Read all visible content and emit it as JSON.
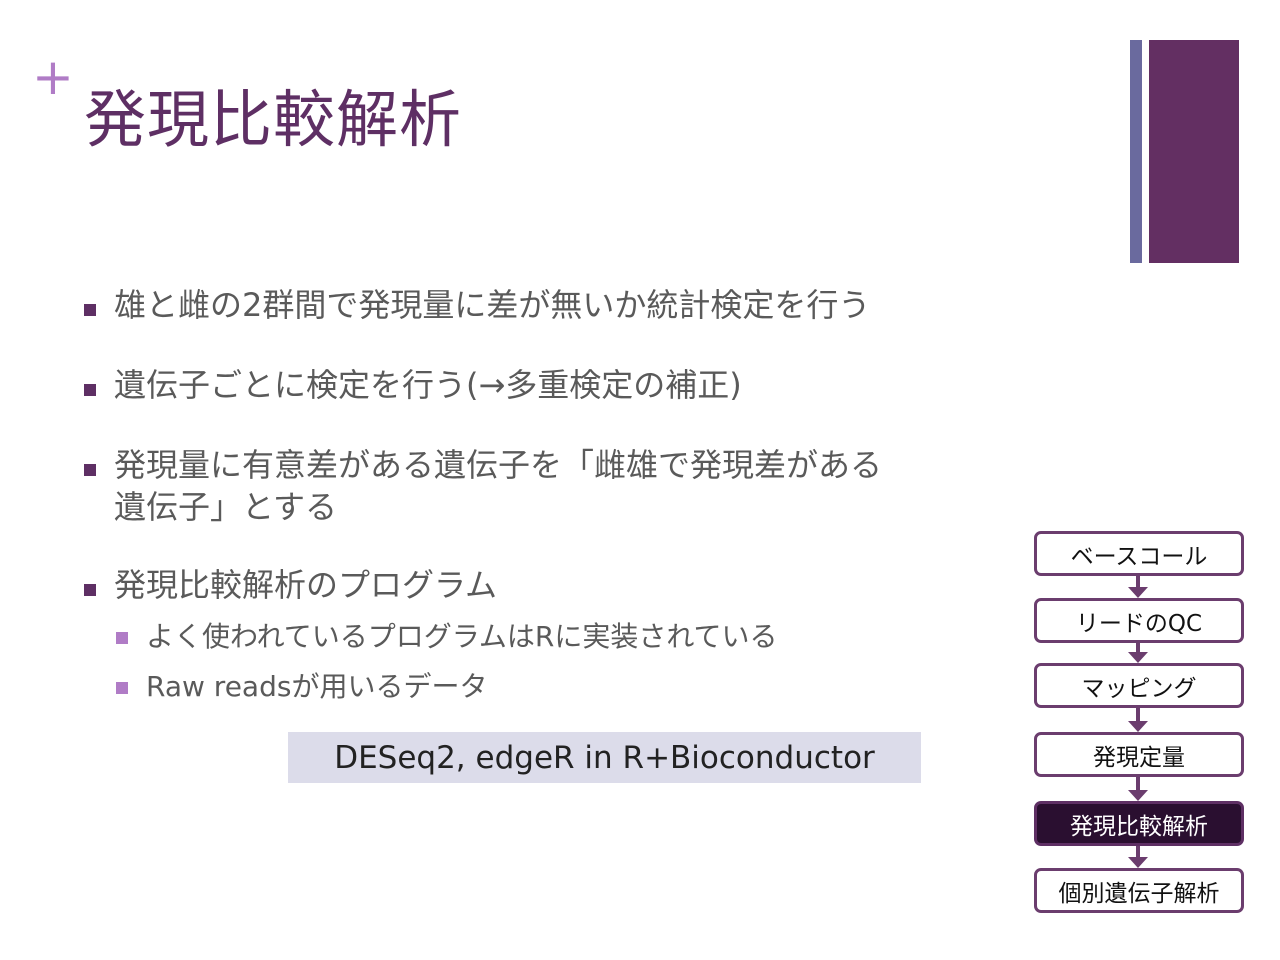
{
  "slide": {
    "plus_glyph": "+",
    "title": "発現比較解析",
    "colors": {
      "title": "#5e2f64",
      "accent_thin_bar": "#6a6a9e",
      "accent_thick_bar": "#632f62",
      "bullet_marker": "#5e2f64",
      "sub_bullet_marker": "#b07cc6",
      "body_text": "#5a5a5a",
      "code_box_bg": "#dcdcea",
      "flow_active_bg": "#2a0f30"
    }
  },
  "bullets": [
    {
      "text": "雄と雌の2群間で発現量に差が無いか統計検定を行う"
    },
    {
      "text": "遺伝子ごとに検定を行う(→多重検定の補正)"
    },
    {
      "text": "発現量に有意差がある遺伝子を「雌雄で発現差がある遺伝子」とする"
    },
    {
      "text": "発現比較解析のプログラム",
      "sub_items": [
        {
          "text": "よく使われているプログラムはRに実装されている"
        },
        {
          "text": "Raw readsが用いるデータ"
        }
      ]
    }
  ],
  "code_box": {
    "text": "DESeq2, edgeR in R+Bioconductor"
  },
  "flow": {
    "steps": [
      {
        "label": "ベースコール",
        "active": false
      },
      {
        "label": "リードのQC",
        "active": false
      },
      {
        "label": "マッピング",
        "active": false
      },
      {
        "label": "発現定量",
        "active": false
      },
      {
        "label": "発現比較解析",
        "active": true
      },
      {
        "label": "個別遺伝子解析",
        "active": false
      }
    ]
  }
}
